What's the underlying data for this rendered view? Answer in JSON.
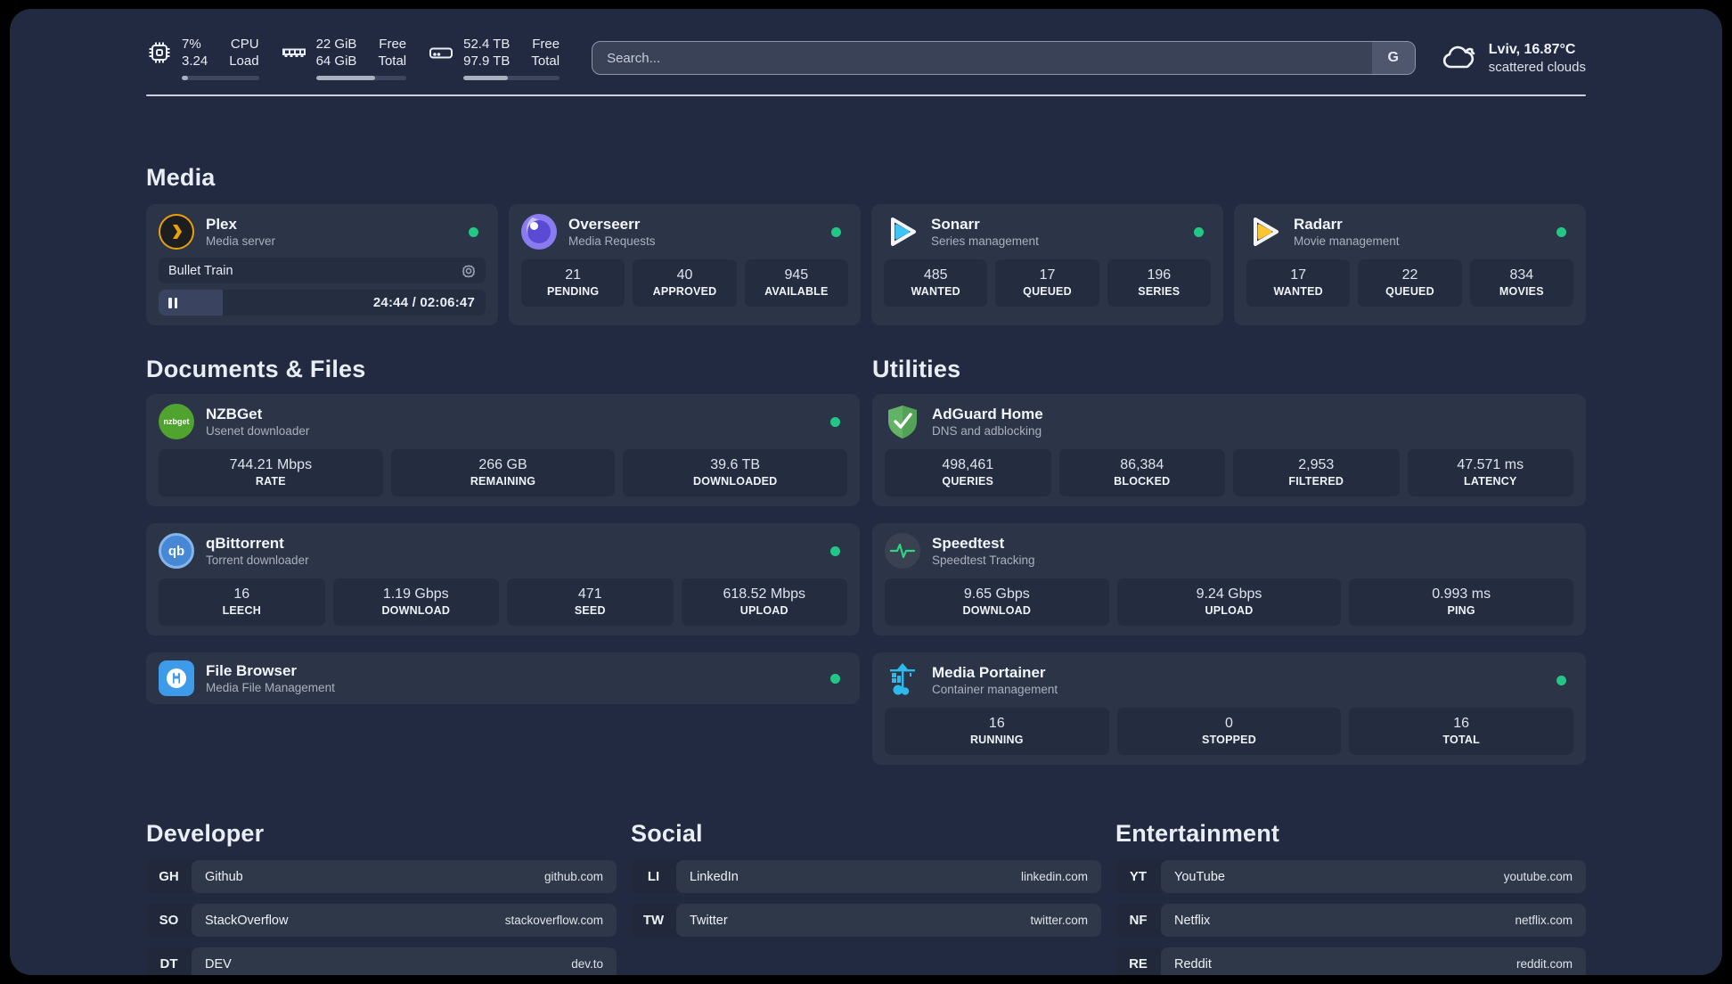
{
  "colors": {
    "background": "#000000",
    "surface": "#222a41",
    "card": "#2c3447",
    "stat_box": "#242c3f",
    "status_online_green": "#22c786",
    "text_primary": "#eef1f6",
    "text_secondary": "#a9b1bf",
    "plex_amber": "#e8a00d",
    "overseerr_purple": "#8a7cf0",
    "sonarr_blue": "#3cc5f5",
    "radarr_yellow": "#fbc531",
    "nzbget_green": "#4fa32e",
    "qbittorrent_blue": "#4687d6",
    "adguard_green": "#63b266",
    "speedtest_green": "#2bd784",
    "portainer_cyan": "#2cb9ec",
    "filebrowser_blue": "#3d9be9"
  },
  "header": {
    "stats": [
      {
        "icon": "cpu-icon",
        "values": [
          "7%",
          "3.24"
        ],
        "labels": [
          "CPU",
          "Load"
        ],
        "progress_pct": 8
      },
      {
        "icon": "ram-icon",
        "values": [
          "22 GiB",
          "64 GiB"
        ],
        "labels": [
          "Free",
          "Total"
        ],
        "progress_pct": 65
      },
      {
        "icon": "disk-icon",
        "values": [
          "52.4 TB",
          "97.9 TB"
        ],
        "labels": [
          "Free",
          "Total"
        ],
        "progress_pct": 46
      }
    ],
    "search": {
      "placeholder": "Search...",
      "engine_button": "G"
    },
    "weather": {
      "location_temp": "Lviv, 16.87°C",
      "condition": "scattered clouds"
    }
  },
  "media": {
    "title": "Media",
    "plex": {
      "title": "Plex",
      "subtitle": "Media server",
      "online": true,
      "now_playing": "Bullet Train",
      "time": "24:44 / 02:06:47",
      "progress_pct": 19.5
    },
    "overseerr": {
      "title": "Overseerr",
      "subtitle": "Media Requests",
      "online": true,
      "stats": [
        {
          "value": "21",
          "label": "PENDING"
        },
        {
          "value": "40",
          "label": "APPROVED"
        },
        {
          "value": "945",
          "label": "AVAILABLE"
        }
      ]
    },
    "sonarr": {
      "title": "Sonarr",
      "subtitle": "Series management",
      "online": true,
      "stats": [
        {
          "value": "485",
          "label": "WANTED"
        },
        {
          "value": "17",
          "label": "QUEUED"
        },
        {
          "value": "196",
          "label": "SERIES"
        }
      ]
    },
    "radarr": {
      "title": "Radarr",
      "subtitle": "Movie management",
      "online": true,
      "stats": [
        {
          "value": "17",
          "label": "WANTED"
        },
        {
          "value": "22",
          "label": "QUEUED"
        },
        {
          "value": "834",
          "label": "MOVIES"
        }
      ]
    }
  },
  "documents": {
    "title": "Documents & Files",
    "nzbget": {
      "title": "NZBGet",
      "subtitle": "Usenet downloader",
      "online": true,
      "icon_text": "nzbget",
      "stats": [
        {
          "value": "744.21 Mbps",
          "label": "RATE"
        },
        {
          "value": "266 GB",
          "label": "REMAINING"
        },
        {
          "value": "39.6 TB",
          "label": "DOWNLOADED"
        }
      ]
    },
    "qbittorrent": {
      "title": "qBittorrent",
      "subtitle": "Torrent downloader",
      "online": true,
      "icon_text": "qb",
      "stats": [
        {
          "value": "16",
          "label": "LEECH"
        },
        {
          "value": "1.19 Gbps",
          "label": "DOWNLOAD"
        },
        {
          "value": "471",
          "label": "SEED"
        },
        {
          "value": "618.52 Mbps",
          "label": "UPLOAD"
        }
      ]
    },
    "filebrowser": {
      "title": "File Browser",
      "subtitle": "Media File Management",
      "online": true
    }
  },
  "utilities": {
    "title": "Utilities",
    "adguard": {
      "title": "AdGuard Home",
      "subtitle": "DNS and adblocking",
      "stats": [
        {
          "value": "498,461",
          "label": "QUERIES"
        },
        {
          "value": "86,384",
          "label": "BLOCKED"
        },
        {
          "value": "2,953",
          "label": "FILTERED"
        },
        {
          "value": "47.571 ms",
          "label": "LATENCY"
        }
      ]
    },
    "speedtest": {
      "title": "Speedtest",
      "subtitle": "Speedtest Tracking",
      "stats": [
        {
          "value": "9.65 Gbps",
          "label": "DOWNLOAD"
        },
        {
          "value": "9.24 Gbps",
          "label": "UPLOAD"
        },
        {
          "value": "0.993 ms",
          "label": "PING"
        }
      ]
    },
    "portainer": {
      "title": "Media Portainer",
      "subtitle": "Container management",
      "online": true,
      "stats": [
        {
          "value": "16",
          "label": "RUNNING"
        },
        {
          "value": "0",
          "label": "STOPPED"
        },
        {
          "value": "16",
          "label": "TOTAL"
        }
      ]
    }
  },
  "links": {
    "developer": {
      "title": "Developer",
      "items": [
        {
          "abbrev": "GH",
          "name": "Github",
          "url": "github.com"
        },
        {
          "abbrev": "SO",
          "name": "StackOverflow",
          "url": "stackoverflow.com"
        },
        {
          "abbrev": "DT",
          "name": "DEV",
          "url": "dev.to"
        }
      ]
    },
    "social": {
      "title": "Social",
      "items": [
        {
          "abbrev": "LI",
          "name": "LinkedIn",
          "url": "linkedin.com"
        },
        {
          "abbrev": "TW",
          "name": "Twitter",
          "url": "twitter.com"
        }
      ]
    },
    "entertainment": {
      "title": "Entertainment",
      "items": [
        {
          "abbrev": "YT",
          "name": "YouTube",
          "url": "youtube.com"
        },
        {
          "abbrev": "NF",
          "name": "Netflix",
          "url": "netflix.com"
        },
        {
          "abbrev": "RE",
          "name": "Reddit",
          "url": "reddit.com"
        }
      ]
    }
  }
}
